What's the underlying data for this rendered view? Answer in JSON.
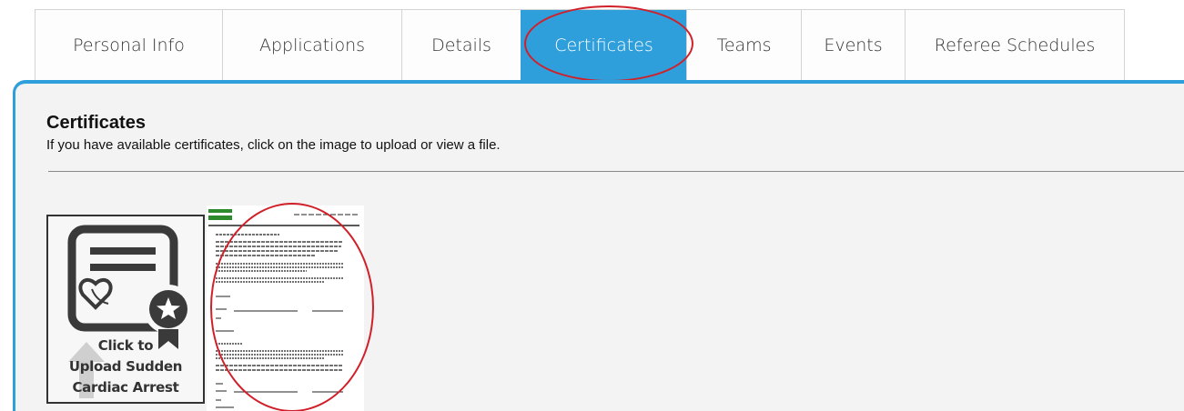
{
  "tabs": [
    {
      "label": "Personal Info",
      "active": false
    },
    {
      "label": "Applications",
      "active": false
    },
    {
      "label": "Details",
      "active": false
    },
    {
      "label": "Certificates",
      "active": true
    },
    {
      "label": "Teams",
      "active": false
    },
    {
      "label": "Events",
      "active": false
    },
    {
      "label": "Referee Schedules",
      "active": false
    }
  ],
  "section": {
    "title": "Certificates",
    "description": "If you have available certificates, click on the image to upload or view a file."
  },
  "certificate_card": {
    "line1": "Click to",
    "line2": "Upload Sudden",
    "line3": "Cardiac Arrest",
    "icon": "certificate-heart-icon"
  },
  "document_thumbnail": {
    "icon": "uploaded-document-preview"
  },
  "colors": {
    "accent": "#2f9fdc",
    "highlight_circle": "#d0202a",
    "panel_bg": "#f3f3f3"
  }
}
